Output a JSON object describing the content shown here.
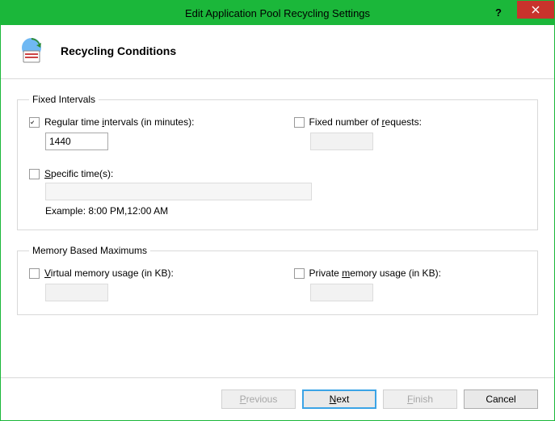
{
  "window": {
    "title": "Edit Application Pool Recycling Settings"
  },
  "header": {
    "title": "Recycling Conditions"
  },
  "groups": {
    "fixed": {
      "legend": "Fixed Intervals",
      "regular": {
        "label_pre": "Regular time ",
        "label_u": "i",
        "label_post": "ntervals (in minutes):",
        "checked": true,
        "value": "1440"
      },
      "requests": {
        "label_pre": "Fixed number of ",
        "label_u": "r",
        "label_post": "equests:",
        "checked": false,
        "value": ""
      },
      "specific": {
        "label_u": "S",
        "label_post": "pecific time(s):",
        "checked": false,
        "value": "",
        "example": "Example: 8:00 PM,12:00 AM"
      }
    },
    "memory": {
      "legend": "Memory Based Maximums",
      "virtual": {
        "label_u": "V",
        "label_post": "irtual memory usage (in KB):",
        "checked": false,
        "value": ""
      },
      "private": {
        "label_pre": "Private ",
        "label_u": "m",
        "label_post": "emory usage (in KB):",
        "checked": false,
        "value": ""
      }
    }
  },
  "buttons": {
    "previous": "Previous",
    "previous_u": "P",
    "previous_post": "revious",
    "next_u": "N",
    "next_post": "ext",
    "finish_u": "F",
    "finish_post": "inish",
    "cancel": "Cancel"
  }
}
